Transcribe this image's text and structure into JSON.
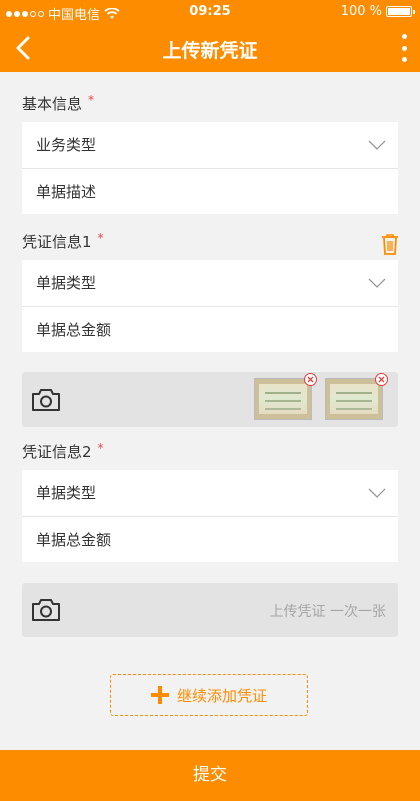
{
  "status_bar": {
    "carrier": "中国电信",
    "time": "09:25",
    "battery": "100 %",
    "signal_icon": "signal-dots-icon",
    "wifi_icon": "wifi-icon"
  },
  "nav": {
    "title": "上传新凭证",
    "back_icon": "chevron-left-icon",
    "more_icon": "more-vertical-icon"
  },
  "basic_info": {
    "label": "基本信息",
    "required_mark": "*",
    "business_type": "业务类型",
    "doc_description": "单据描述"
  },
  "vouchers": [
    {
      "label": "凭证信息1",
      "required_mark": "*",
      "doc_type": "单据类型",
      "total_amount": "单据总金额",
      "delete_icon": "trash-icon"
    },
    {
      "label": "凭证信息2",
      "required_mark": "*",
      "doc_type": "单据类型",
      "total_amount": "单据总金额",
      "upload_hint": "上传凭证 一次一张"
    }
  ],
  "add_voucher_label": "继续添加凭证",
  "submit_label": "提交",
  "colors": {
    "accent": "#fd8c00",
    "required": "#e8464a",
    "background": "#f2f2f2"
  }
}
